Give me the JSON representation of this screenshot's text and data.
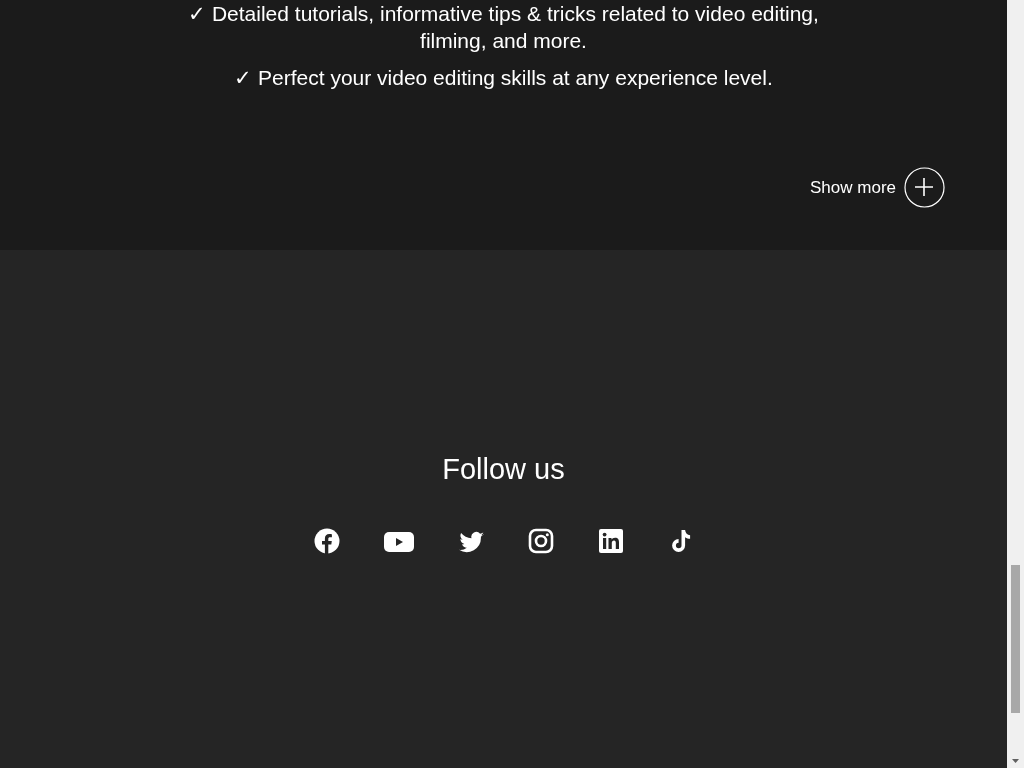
{
  "features": [
    "✓ Detailed tutorials, informative tips & tricks related to video editing, filming, and more.",
    "✓ Perfect your video editing skills at any experience level."
  ],
  "show_more": {
    "label": "Show more",
    "expanded": false
  },
  "follow": {
    "title": "Follow us",
    "links": [
      {
        "kind": "facebook"
      },
      {
        "kind": "youtube"
      },
      {
        "kind": "twitter"
      },
      {
        "kind": "instagram"
      },
      {
        "kind": "linkedin"
      },
      {
        "kind": "tiktok"
      }
    ]
  }
}
